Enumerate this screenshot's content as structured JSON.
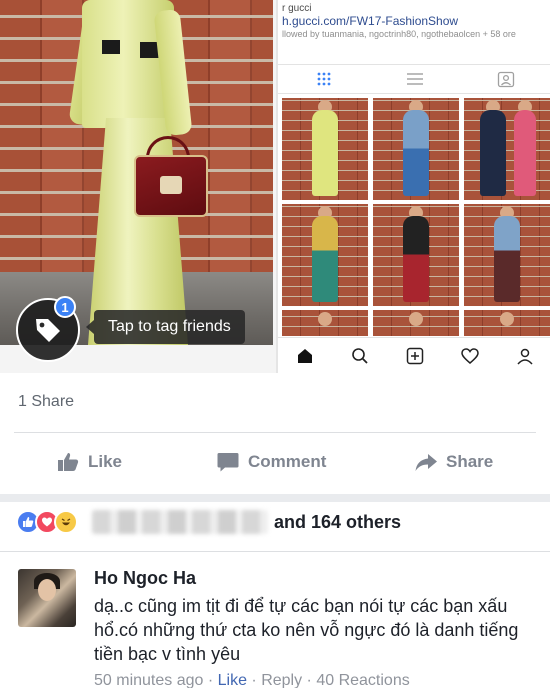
{
  "post": {
    "tag_prompt": "Tap to tag friends",
    "tag_count": "1",
    "embedded_profile": {
      "header_line": "r gucci",
      "url": "h.gucci.com/FW17-FashionShow",
      "followed_by": "llowed by tuanmania, ngoctrinh80, ngothebaolcen + 58 ore"
    }
  },
  "shares": {
    "label": "1 Share"
  },
  "actions": {
    "like": "Like",
    "comment": "Comment",
    "share": "Share"
  },
  "reactions": {
    "icons": [
      "like-reaction",
      "love-reaction",
      "haha-reaction"
    ],
    "others_text": "and 164 others"
  },
  "comment": {
    "author": "Ho Ngoc Ha",
    "text": "dạ..c cũng im tịt đi để tự các bạn nói tự các bạn xấu hổ.có những thứ cta ko nên vỗ ngực đó là danh tiếng tiền bạc v tình yêu",
    "time": "50 minutes ago",
    "separator": " · ",
    "like": "Like",
    "reply": "Reply",
    "reactions": "40 Reactions"
  },
  "colors": {
    "fb_blue": "#4267b2",
    "secondary_text": "#606770",
    "action_grey": "#7f8590"
  }
}
